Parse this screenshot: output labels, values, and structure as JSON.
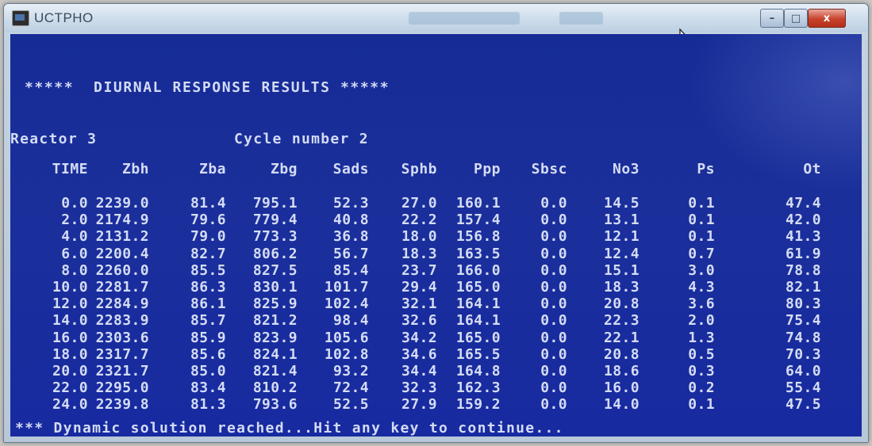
{
  "window": {
    "title": "UCTPHO",
    "controls": {
      "minimize": "–",
      "maximize": "□",
      "close": "x"
    }
  },
  "console": {
    "heading": "*****  DIURNAL RESPONSE RESULTS *****",
    "reactor": "Reactor 3",
    "cycle": "Cycle number 2",
    "columns": [
      "TIME",
      "Zbh",
      "Zba",
      "Zbg",
      "Sads",
      "Sphb",
      "Ppp",
      "Sbsc",
      "No3",
      "Ps",
      "Ot"
    ],
    "rows": [
      [
        "0.0",
        "2239.0",
        "81.4",
        "795.1",
        "52.3",
        "27.0",
        "160.1",
        "0.0",
        "14.5",
        "0.1",
        "47.4"
      ],
      [
        "2.0",
        "2174.9",
        "79.6",
        "779.4",
        "40.8",
        "22.2",
        "157.4",
        "0.0",
        "13.1",
        "0.1",
        "42.0"
      ],
      [
        "4.0",
        "2131.2",
        "79.0",
        "773.3",
        "36.8",
        "18.0",
        "156.8",
        "0.0",
        "12.1",
        "0.1",
        "41.3"
      ],
      [
        "6.0",
        "2200.4",
        "82.7",
        "806.2",
        "56.7",
        "18.3",
        "163.5",
        "0.0",
        "12.4",
        "0.7",
        "61.9"
      ],
      [
        "8.0",
        "2260.0",
        "85.5",
        "827.5",
        "85.4",
        "23.7",
        "166.0",
        "0.0",
        "15.1",
        "3.0",
        "78.8"
      ],
      [
        "10.0",
        "2281.7",
        "86.3",
        "830.1",
        "101.7",
        "29.4",
        "165.0",
        "0.0",
        "18.3",
        "4.3",
        "82.1"
      ],
      [
        "12.0",
        "2284.9",
        "86.1",
        "825.9",
        "102.4",
        "32.1",
        "164.1",
        "0.0",
        "20.8",
        "3.6",
        "80.3"
      ],
      [
        "14.0",
        "2283.9",
        "85.7",
        "821.2",
        "98.4",
        "32.6",
        "164.1",
        "0.0",
        "22.3",
        "2.0",
        "75.4"
      ],
      [
        "16.0",
        "2303.6",
        "85.9",
        "823.9",
        "105.6",
        "34.2",
        "165.0",
        "0.0",
        "22.1",
        "1.3",
        "74.8"
      ],
      [
        "18.0",
        "2317.7",
        "85.6",
        "824.1",
        "102.8",
        "34.6",
        "165.5",
        "0.0",
        "20.8",
        "0.5",
        "70.3"
      ],
      [
        "20.0",
        "2321.7",
        "85.0",
        "821.4",
        "93.2",
        "34.4",
        "164.8",
        "0.0",
        "18.6",
        "0.3",
        "64.0"
      ],
      [
        "22.0",
        "2295.0",
        "83.4",
        "810.2",
        "72.4",
        "32.3",
        "162.3",
        "0.0",
        "16.0",
        "0.2",
        "55.4"
      ],
      [
        "24.0",
        "2239.8",
        "81.3",
        "793.6",
        "52.5",
        "27.9",
        "159.2",
        "0.0",
        "14.0",
        "0.1",
        "47.5"
      ]
    ],
    "status": "*** Dynamic solution reached...Hit any key to continue..."
  },
  "colors": {
    "console_bg": "#1b2f9b",
    "console_text": "#d4dcf4",
    "close_button": "#c8412b"
  },
  "icons": [
    "app-icon",
    "cursor-icon",
    "minimize-icon",
    "maximize-icon",
    "close-icon"
  ]
}
